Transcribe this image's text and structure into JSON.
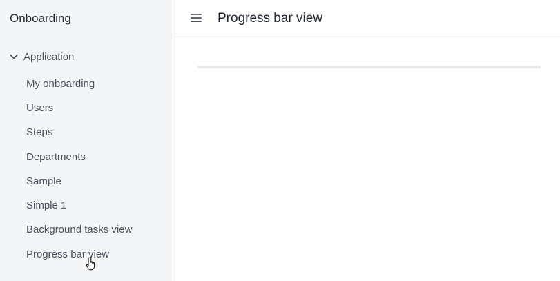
{
  "sidebar": {
    "app_title": "Onboarding",
    "group": {
      "label": "Application",
      "expanded": true,
      "icon": "chevron-down-icon"
    },
    "items": [
      {
        "label": "My onboarding"
      },
      {
        "label": "Users"
      },
      {
        "label": "Steps"
      },
      {
        "label": "Departments"
      },
      {
        "label": "Sample"
      },
      {
        "label": "Simple 1"
      },
      {
        "label": "Background tasks view"
      },
      {
        "label": "Progress bar view"
      }
    ]
  },
  "header": {
    "menu_icon": "hamburger-menu-icon",
    "title": "Progress bar view"
  },
  "main": {
    "progress": {
      "value": 0,
      "track_color": "#e8e9eb"
    }
  },
  "colors": {
    "sidebar_bg": "#f4f5f7",
    "text_primary": "#1f2733",
    "text_secondary": "#4a5261"
  }
}
